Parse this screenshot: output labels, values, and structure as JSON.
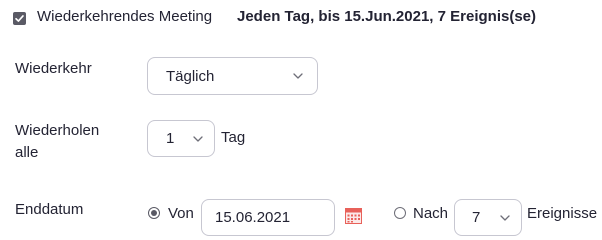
{
  "recurring": {
    "checked": true,
    "label": "Wiederkehrendes Meeting",
    "summary": "Jeden Tag, bis 15.Jun.2021, 7 Ereignis(se)"
  },
  "recurrence": {
    "label": "Wiederkehr",
    "selected": "Täglich"
  },
  "repeat_every": {
    "label_line1": "Wiederholen",
    "label_line2": "alle",
    "selected": "1",
    "unit": "Tag"
  },
  "end_date": {
    "label": "Enddatum",
    "option_by_label": "Von",
    "date_value": "15.06.2021",
    "option_after_label": "Nach",
    "occurrences_selected": "7",
    "occurrences_unit": "Ereignisse",
    "selected_option": "Von"
  },
  "colors": {
    "text": "#232333",
    "border": "#c7c7d1",
    "control": "#5a5a65",
    "calendar_accent": "#e8615a"
  },
  "icons": [
    "check-icon",
    "chevron-down-icon",
    "calendar-icon"
  ]
}
